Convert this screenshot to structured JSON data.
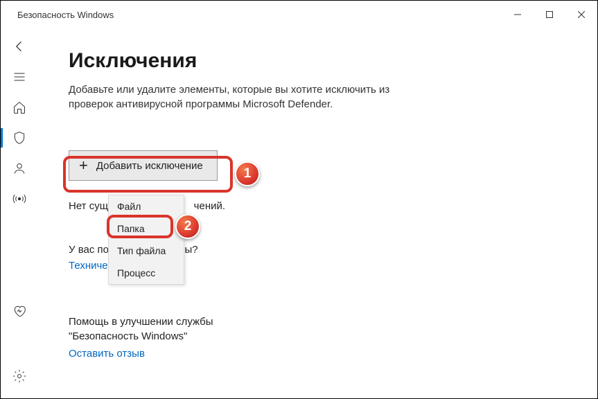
{
  "window": {
    "title": "Безопасность Windows"
  },
  "page": {
    "title": "Исключения",
    "description": "Добавьте или удалите элементы, которые вы хотите исключить из проверок антивирусной программы Microsoft Defender.",
    "add_button": "Добавить исключение",
    "no_exclusions_prefix": "Нет сущест",
    "no_exclusions_suffix": "чений.",
    "question_prefix": "У вас появ",
    "question_suffix": "ы?",
    "support_link_prefix": "Техническа",
    "feedback_label": "Помощь в улучшении службы \"Безопасность Windows\"",
    "feedback_link": "Оставить отзыв"
  },
  "dropdown": {
    "items": [
      "Файл",
      "Папка",
      "Тип файла",
      "Процесс"
    ]
  },
  "markers": {
    "one": "1",
    "two": "2"
  }
}
